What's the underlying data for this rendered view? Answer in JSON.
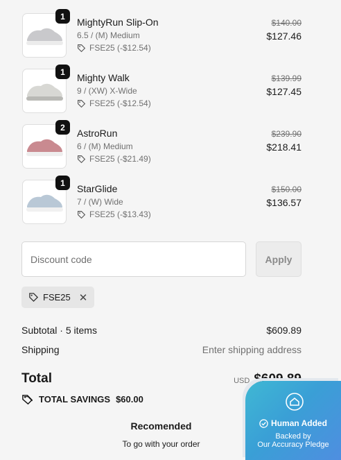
{
  "items": [
    {
      "qty": "1",
      "name": "MightyRun Slip-On",
      "variant": "6.5 / (M) Medium",
      "discount": "FSE25 (-$12.54)",
      "old_price": "$140.00",
      "price": "$127.46",
      "shoe_color": "#c9c9cc",
      "sole_color": "#ececec"
    },
    {
      "qty": "1",
      "name": "Mighty Walk",
      "variant": "9 / (XW) X-Wide",
      "discount": "FSE25 (-$12.54)",
      "old_price": "$139.99",
      "price": "$127.45",
      "shoe_color": "#d8d8d4",
      "sole_color": "#b9b9b5"
    },
    {
      "qty": "2",
      "name": "AstroRun",
      "variant": "6 / (M) Medium",
      "discount": "FSE25 (-$21.49)",
      "old_price": "$239.90",
      "price": "$218.41",
      "shoe_color": "#c98a90",
      "sole_color": "#eeeeee"
    },
    {
      "qty": "1",
      "name": "StarGlide",
      "variant": "7 / (W) Wide",
      "discount": "FSE25 (-$13.43)",
      "old_price": "$150.00",
      "price": "$136.57",
      "shoe_color": "#b9c8d6",
      "sole_color": "#f1f1f1"
    }
  ],
  "discount": {
    "placeholder": "Discount code",
    "value": "",
    "apply_label": "Apply",
    "applied_code": "FSE25"
  },
  "summary": {
    "subtotal_label": "Subtotal · 5 items",
    "subtotal_value": "$609.89",
    "shipping_label": "Shipping",
    "shipping_value": "Enter shipping address",
    "total_label": "Total",
    "currency": "USD",
    "total_value": "$609.89",
    "savings_label": "TOTAL SAVINGS",
    "savings_value": "$60.00"
  },
  "recommended": {
    "title": "Recomended",
    "subtitle": "To go with your order"
  },
  "badge": {
    "title": "Human Added",
    "line1": "Backed by",
    "line2": "Our Accuracy Pledge"
  },
  "colors": {
    "badge_start": "#3fb8d4",
    "badge_end": "#4f8ee0",
    "qty_badge": "#111111",
    "background": "#f5f5f5"
  },
  "icons": [
    "tag-icon",
    "close-icon",
    "shield-icon",
    "check-circle-icon"
  ]
}
